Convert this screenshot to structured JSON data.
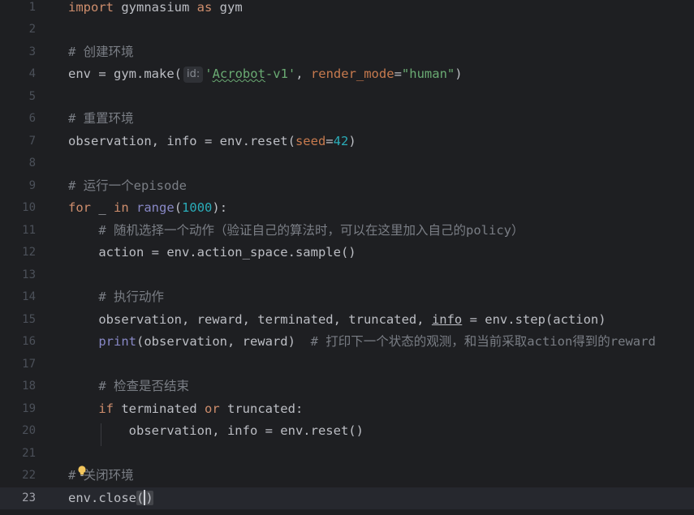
{
  "editor": {
    "lines": [
      {
        "num": "1",
        "tokens": [
          {
            "t": "import",
            "c": "kw"
          },
          {
            "t": " gymnasium ",
            "c": "plain"
          },
          {
            "t": "as",
            "c": "kw"
          },
          {
            "t": " gym",
            "c": "plain"
          }
        ]
      },
      {
        "num": "2",
        "tokens": []
      },
      {
        "num": "3",
        "tokens": [
          {
            "t": "# 创建环境",
            "c": "cmt"
          }
        ]
      },
      {
        "num": "4",
        "tokens": [
          {
            "t": "env = gym.make(",
            "c": "plain"
          },
          {
            "t": "id:",
            "c": "inlay"
          },
          {
            "t": "'",
            "c": "str"
          },
          {
            "t": "Acrobot",
            "c": "str typo"
          },
          {
            "t": "-v1'",
            "c": "str"
          },
          {
            "t": ", ",
            "c": "plain"
          },
          {
            "t": "render_mode",
            "c": "param"
          },
          {
            "t": "=",
            "c": "plain"
          },
          {
            "t": "\"human\"",
            "c": "str"
          },
          {
            "t": ")",
            "c": "plain"
          }
        ]
      },
      {
        "num": "5",
        "tokens": []
      },
      {
        "num": "6",
        "tokens": [
          {
            "t": "# 重置环境",
            "c": "cmt"
          }
        ]
      },
      {
        "num": "7",
        "tokens": [
          {
            "t": "observation, info = env.reset(",
            "c": "plain"
          },
          {
            "t": "seed",
            "c": "param"
          },
          {
            "t": "=",
            "c": "plain"
          },
          {
            "t": "42",
            "c": "num"
          },
          {
            "t": ")",
            "c": "plain"
          }
        ]
      },
      {
        "num": "8",
        "tokens": []
      },
      {
        "num": "9",
        "tokens": [
          {
            "t": "# 运行一个episode",
            "c": "cmt"
          }
        ]
      },
      {
        "num": "10",
        "tokens": [
          {
            "t": "for",
            "c": "kw"
          },
          {
            "t": " _ ",
            "c": "plain"
          },
          {
            "t": "in",
            "c": "kw"
          },
          {
            "t": " ",
            "c": "plain"
          },
          {
            "t": "range",
            "c": "builtin"
          },
          {
            "t": "(",
            "c": "plain"
          },
          {
            "t": "1000",
            "c": "num"
          },
          {
            "t": "):",
            "c": "plain"
          }
        ]
      },
      {
        "num": "11",
        "tokens": [
          {
            "t": "    # 随机选择一个动作（验证自己的算法时，可以在这里加入自己的policy）",
            "c": "cmt"
          }
        ]
      },
      {
        "num": "12",
        "tokens": [
          {
            "t": "    action = env.action_space.sample()",
            "c": "plain"
          }
        ]
      },
      {
        "num": "13",
        "tokens": []
      },
      {
        "num": "14",
        "tokens": [
          {
            "t": "    # 执行动作",
            "c": "cmt"
          }
        ]
      },
      {
        "num": "15",
        "tokens": [
          {
            "t": "    observation, reward, terminated, truncated, ",
            "c": "plain"
          },
          {
            "t": "info",
            "c": "under"
          },
          {
            "t": " = env.step(action)",
            "c": "plain"
          }
        ]
      },
      {
        "num": "16",
        "tokens": [
          {
            "t": "    ",
            "c": "plain"
          },
          {
            "t": "print",
            "c": "builtin"
          },
          {
            "t": "(observation, reward)  ",
            "c": "plain"
          },
          {
            "t": "# 打印下一个状态的观测，和当前采取action得到的reward",
            "c": "cmt"
          }
        ]
      },
      {
        "num": "17",
        "tokens": []
      },
      {
        "num": "18",
        "tokens": [
          {
            "t": "    # 检查是否结束",
            "c": "cmt"
          }
        ]
      },
      {
        "num": "19",
        "tokens": [
          {
            "t": "    ",
            "c": "plain"
          },
          {
            "t": "if",
            "c": "kw"
          },
          {
            "t": " terminated ",
            "c": "plain"
          },
          {
            "t": "or",
            "c": "kw"
          },
          {
            "t": " truncated:",
            "c": "plain"
          }
        ]
      },
      {
        "num": "20",
        "tokens": [
          {
            "t": "        observation, info = env.reset()",
            "c": "plain"
          }
        ]
      },
      {
        "num": "21",
        "tokens": []
      },
      {
        "num": "22",
        "tokens": [
          {
            "t": "# 关闭环境",
            "c": "cmt"
          }
        ]
      },
      {
        "num": "23",
        "tokens": [
          {
            "t": "env.close",
            "c": "plain"
          },
          {
            "t": "(",
            "c": "parenmatch"
          },
          {
            "t": ")",
            "c": "parenmatch-cursor"
          }
        ]
      }
    ],
    "current_line": "23",
    "icons": {
      "intention_bulb": "lightbulb-icon"
    },
    "colors": {
      "background": "#1e1f22",
      "keyword": "#cf8e6d",
      "string": "#6aab73",
      "number": "#2aacb8",
      "comment": "#7a7e85",
      "param": "#c77a4e",
      "builtin": "#8888c6"
    }
  }
}
